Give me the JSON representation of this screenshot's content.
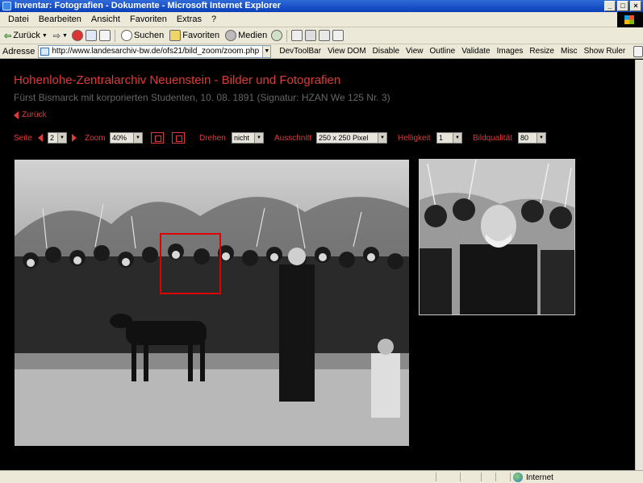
{
  "window": {
    "title": "Inventar: Fotografien - Dokumente - Microsoft Internet Explorer",
    "buttons": {
      "minimize": "_",
      "maximize": "□",
      "close": "×"
    }
  },
  "menu": [
    "Datei",
    "Bearbeiten",
    "Ansicht",
    "Favoriten",
    "Extras",
    "?"
  ],
  "toolbar": {
    "back": "Zurück",
    "search": "Suchen",
    "favorites": "Favoriten",
    "media": "Medien"
  },
  "address": {
    "label": "Adresse",
    "url": "http://www.landesarchiv-bw.de/ofs21/bild_zoom/zoom.php"
  },
  "devbar": [
    "DevToolBar",
    "View DOM",
    "Disable",
    "View",
    "Outline",
    "Validate",
    "Images",
    "Resize",
    "Misc",
    "Show Ruler"
  ],
  "page": {
    "title": "Hohenlohe-Zentralarchiv Neuenstein - Bilder und Fotografien",
    "subtitle": "Fürst Bismarck mit korporierten Studenten, 10. 08. 1891 (Signatur: HZAN We 125 Nr. 3)",
    "back_link": "Zurück"
  },
  "controls": {
    "seite_label": "Seite",
    "seite_value": "2",
    "zoom_label": "Zoom",
    "zoom_value": "40%",
    "drehen_label": "Drehen",
    "drehen_value": "nicht",
    "ausschnitt_label": "Ausschnitt",
    "ausschnitt_value": "250 x 250 Pixel",
    "helligkeit_label": "Helligkeit",
    "helligkeit_value": "1",
    "bildqualitaet_label": "Bildqualität",
    "bildqualitaet_value": "80"
  },
  "status": {
    "zone": "Internet"
  },
  "colors": {
    "accent": "#e03a3a",
    "subtitle": "#666666",
    "background": "#000000"
  },
  "icons": [
    "back-arrow-icon",
    "forward-arrow-icon",
    "stop-icon",
    "refresh-icon",
    "home-icon",
    "search-icon",
    "favorites-icon",
    "media-icon",
    "history-icon",
    "mail-icon",
    "print-icon",
    "edit-icon",
    "discuss-icon",
    "fit-page-icon",
    "fit-width-icon",
    "internet-zone-icon"
  ]
}
